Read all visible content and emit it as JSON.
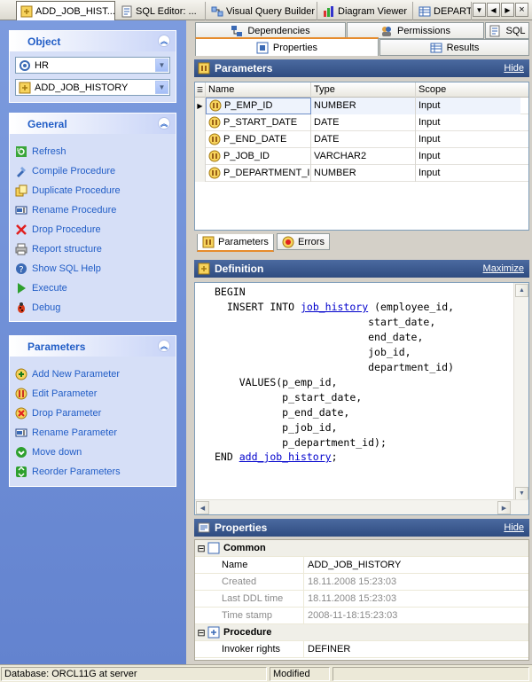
{
  "doc_tabs": [
    {
      "label": "ADD_JOB_HIST...",
      "icon": "procedure-icon",
      "active": true
    },
    {
      "label": "SQL Editor: ...",
      "icon": "sql-editor-icon"
    },
    {
      "label": "Visual Query Builder",
      "icon": "query-builder-icon"
    },
    {
      "label": "Diagram Viewer",
      "icon": "diagram-icon"
    },
    {
      "label": "DEPART",
      "icon": "table-icon"
    }
  ],
  "object_panel": {
    "title": "Object",
    "schema": "HR",
    "object": "ADD_JOB_HISTORY"
  },
  "general_panel": {
    "title": "General",
    "items": [
      {
        "label": "Refresh",
        "icon": "refresh-icon"
      },
      {
        "label": "Compile Procedure",
        "icon": "compile-icon"
      },
      {
        "label": "Duplicate Procedure",
        "icon": "duplicate-icon"
      },
      {
        "label": "Rename Procedure",
        "icon": "rename-icon"
      },
      {
        "label": "Drop Procedure",
        "icon": "drop-icon"
      },
      {
        "label": "Report structure",
        "icon": "printer-icon"
      },
      {
        "label": "Show SQL Help",
        "icon": "help-icon"
      },
      {
        "label": "Execute",
        "icon": "execute-icon"
      },
      {
        "label": "Debug",
        "icon": "debug-icon"
      }
    ]
  },
  "parameters_panel": {
    "title": "Parameters",
    "items": [
      {
        "label": "Add New Parameter",
        "icon": "add-parameter-icon"
      },
      {
        "label": "Edit Parameter",
        "icon": "edit-parameter-icon"
      },
      {
        "label": "Drop Parameter",
        "icon": "drop-parameter-icon"
      },
      {
        "label": "Rename Parameter",
        "icon": "rename-parameter-icon"
      },
      {
        "label": "Move down",
        "icon": "move-down-icon"
      },
      {
        "label": "Reorder Parameters",
        "icon": "reorder-icon"
      }
    ]
  },
  "editor_tabs": {
    "dependencies": "Dependencies",
    "permissions": "Permissions",
    "sql": "SQL",
    "properties": "Properties",
    "results": "Results"
  },
  "parameters_section": {
    "title": "Parameters",
    "hide_label": "Hide",
    "columns": [
      "Name",
      "Type",
      "Scope"
    ],
    "rows": [
      {
        "name": "P_EMP_ID",
        "type": "NUMBER",
        "scope": "Input"
      },
      {
        "name": "P_START_DATE",
        "type": "DATE",
        "scope": "Input"
      },
      {
        "name": "P_END_DATE",
        "type": "DATE",
        "scope": "Input"
      },
      {
        "name": "P_JOB_ID",
        "type": "VARCHAR2",
        "scope": "Input"
      },
      {
        "name": "P_DEPARTMENT_ID",
        "type": "NUMBER",
        "scope": "Input"
      }
    ],
    "bottom_tabs": {
      "parameters": "Parameters",
      "errors": "Errors"
    }
  },
  "definition_section": {
    "title": "Definition",
    "maximize_label": "Maximize",
    "code": {
      "begin": "BEGIN",
      "insert_into": "INSERT INTO",
      "table_link": "job_history",
      "cols": [
        "(employee_id,",
        "start_date,",
        "end_date,",
        "job_id,",
        "department_id)"
      ],
      "values_kw": "VALUES",
      "values": [
        "(p_emp_id,",
        "p_start_date,",
        "p_end_date,",
        "p_job_id,",
        "p_department_id);"
      ],
      "end_kw": "END",
      "end_link": "add_job_history",
      "end_semicolon": ";"
    }
  },
  "properties_section": {
    "title": "Properties",
    "hide_label": "Hide",
    "categories": [
      {
        "name": "Common",
        "rows": [
          {
            "name": "Name",
            "value": "ADD_JOB_HISTORY",
            "readonly": false
          },
          {
            "name": "Created",
            "value": "18.11.2008 15:23:03",
            "readonly": true
          },
          {
            "name": "Last DDL time",
            "value": "18.11.2008 15:23:03",
            "readonly": true
          },
          {
            "name": "Time stamp",
            "value": "2008-11-18:15:23:03",
            "readonly": true
          }
        ]
      },
      {
        "name": "Procedure",
        "rows": [
          {
            "name": "Invoker rights",
            "value": "DEFINER",
            "readonly": false
          }
        ]
      }
    ]
  },
  "status_bar": {
    "database": "Database: ORCL11G at server",
    "state": "Modified"
  }
}
